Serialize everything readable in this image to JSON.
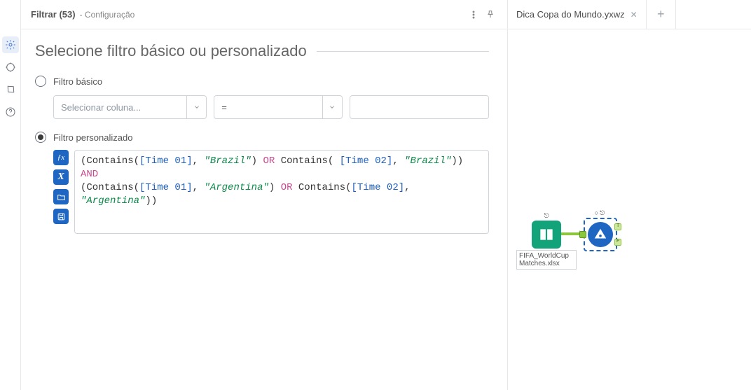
{
  "header": {
    "title": "Filtrar (53)",
    "subtitle": "- Configuração"
  },
  "section": {
    "heading": "Selecione filtro básico ou personalizado"
  },
  "basic": {
    "radio_label": "Filtro básico",
    "column_placeholder": "Selecionar coluna...",
    "operator": "="
  },
  "custom": {
    "radio_label": "Filtro personalizado"
  },
  "expr": {
    "open1": "(Contains(",
    "col_t1": "[Time 01]",
    "c1": ", ",
    "str_br": "\"Brazil\"",
    "cp": ") ",
    "or": "OR",
    "sp": " Contains( ",
    "col_t2": "[Time 02]",
    "c2": ", ",
    "str_br2": "\"Brazil\"",
    "close1": "))",
    "and": "AND",
    "open2": "(Contains(",
    "col_t1b": "[Time 01]",
    "c3": ", ",
    "str_ar": "\"Argentina\"",
    "cp2": ") ",
    "or2": "OR",
    "sp2": " Contains(",
    "col_t2b": "[Time 02]",
    "c4": ", ",
    "str_ar2": "\"Argentina\"",
    "close2": "))"
  },
  "canvas": {
    "tab": "Dica Copa do Mundo.yxwz",
    "input_label": "FIFA_WorldCupMatches.xlsx",
    "input_top": "⎋",
    "filter_top": "○⎋"
  }
}
